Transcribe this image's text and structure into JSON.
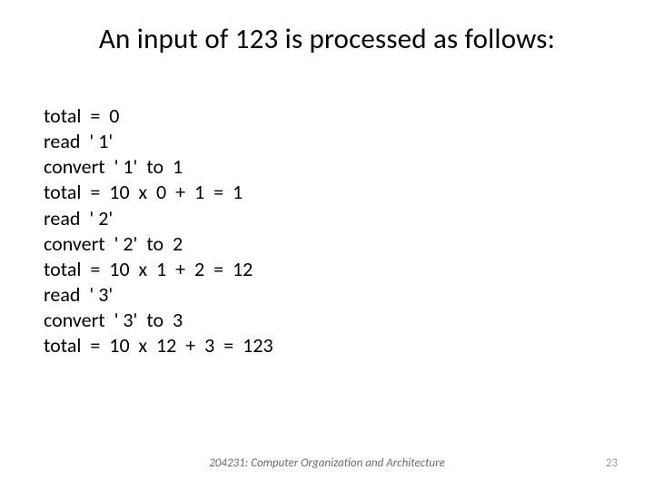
{
  "title": "An input of 123 is processed as follows:",
  "lines": [
    "total  =  0",
    "read  ' 1'",
    "convert  ' 1'  to  1",
    "total  =  10  x  0  +  1  =  1",
    "read  ' 2'",
    "convert  ' 2'  to  2",
    "total  =  10  x  1  +  2  =  12",
    "read  ' 3'",
    "convert  ' 3'  to  3",
    "total  =  10  x  12  +  3  =  123"
  ],
  "footer": {
    "course": "204231: Computer Organization and Architecture",
    "page": "23"
  }
}
